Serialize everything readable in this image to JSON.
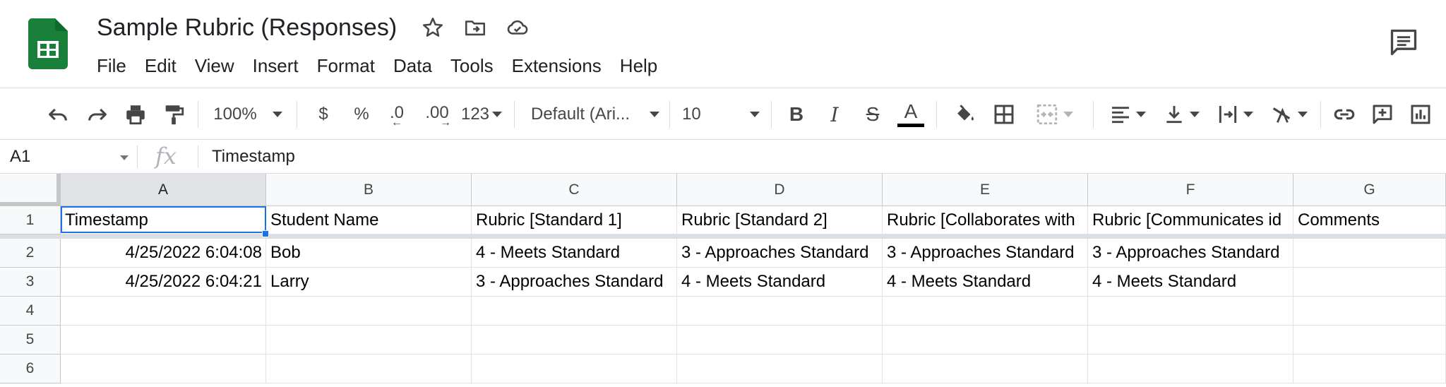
{
  "app": {
    "title": "Sample Rubric (Responses)",
    "accent_color": "#1a73e8",
    "logo_color": "#188038"
  },
  "menu": [
    "File",
    "Edit",
    "View",
    "Insert",
    "Format",
    "Data",
    "Tools",
    "Extensions",
    "Help"
  ],
  "toolbar": {
    "zoom": "100%",
    "currency": "$",
    "percent": "%",
    "decrease_decimal": ".0",
    "increase_decimal": ".00",
    "more_formats": "123",
    "font": "Default (Ari...",
    "font_size": "10"
  },
  "formula_bar": {
    "cell_ref": "A1",
    "fx": "fx",
    "value": "Timestamp"
  },
  "columns": [
    "A",
    "B",
    "C",
    "D",
    "E",
    "F",
    "G"
  ],
  "rows": [
    "1",
    "2",
    "3",
    "4",
    "5",
    "6"
  ],
  "cells": [
    [
      "Timestamp",
      "Student Name",
      "Rubric [Standard 1]",
      "Rubric [Standard 2]",
      "Rubric [Collaborates with",
      "Rubric [Communicates id",
      "Comments"
    ],
    [
      "4/25/2022 6:04:08",
      "Bob",
      "4 - Meets Standard",
      "3 - Approaches Standard",
      "3 - Approaches Standard",
      "3 - Approaches Standard",
      ""
    ],
    [
      "4/25/2022 6:04:21",
      "Larry",
      "3 - Approaches Standard",
      "4 - Meets Standard",
      "4 - Meets Standard",
      "4 - Meets Standard",
      ""
    ],
    [
      "",
      "",
      "",
      "",
      "",
      "",
      ""
    ],
    [
      "",
      "",
      "",
      "",
      "",
      "",
      ""
    ],
    [
      "",
      "",
      "",
      "",
      "",
      "",
      ""
    ]
  ]
}
